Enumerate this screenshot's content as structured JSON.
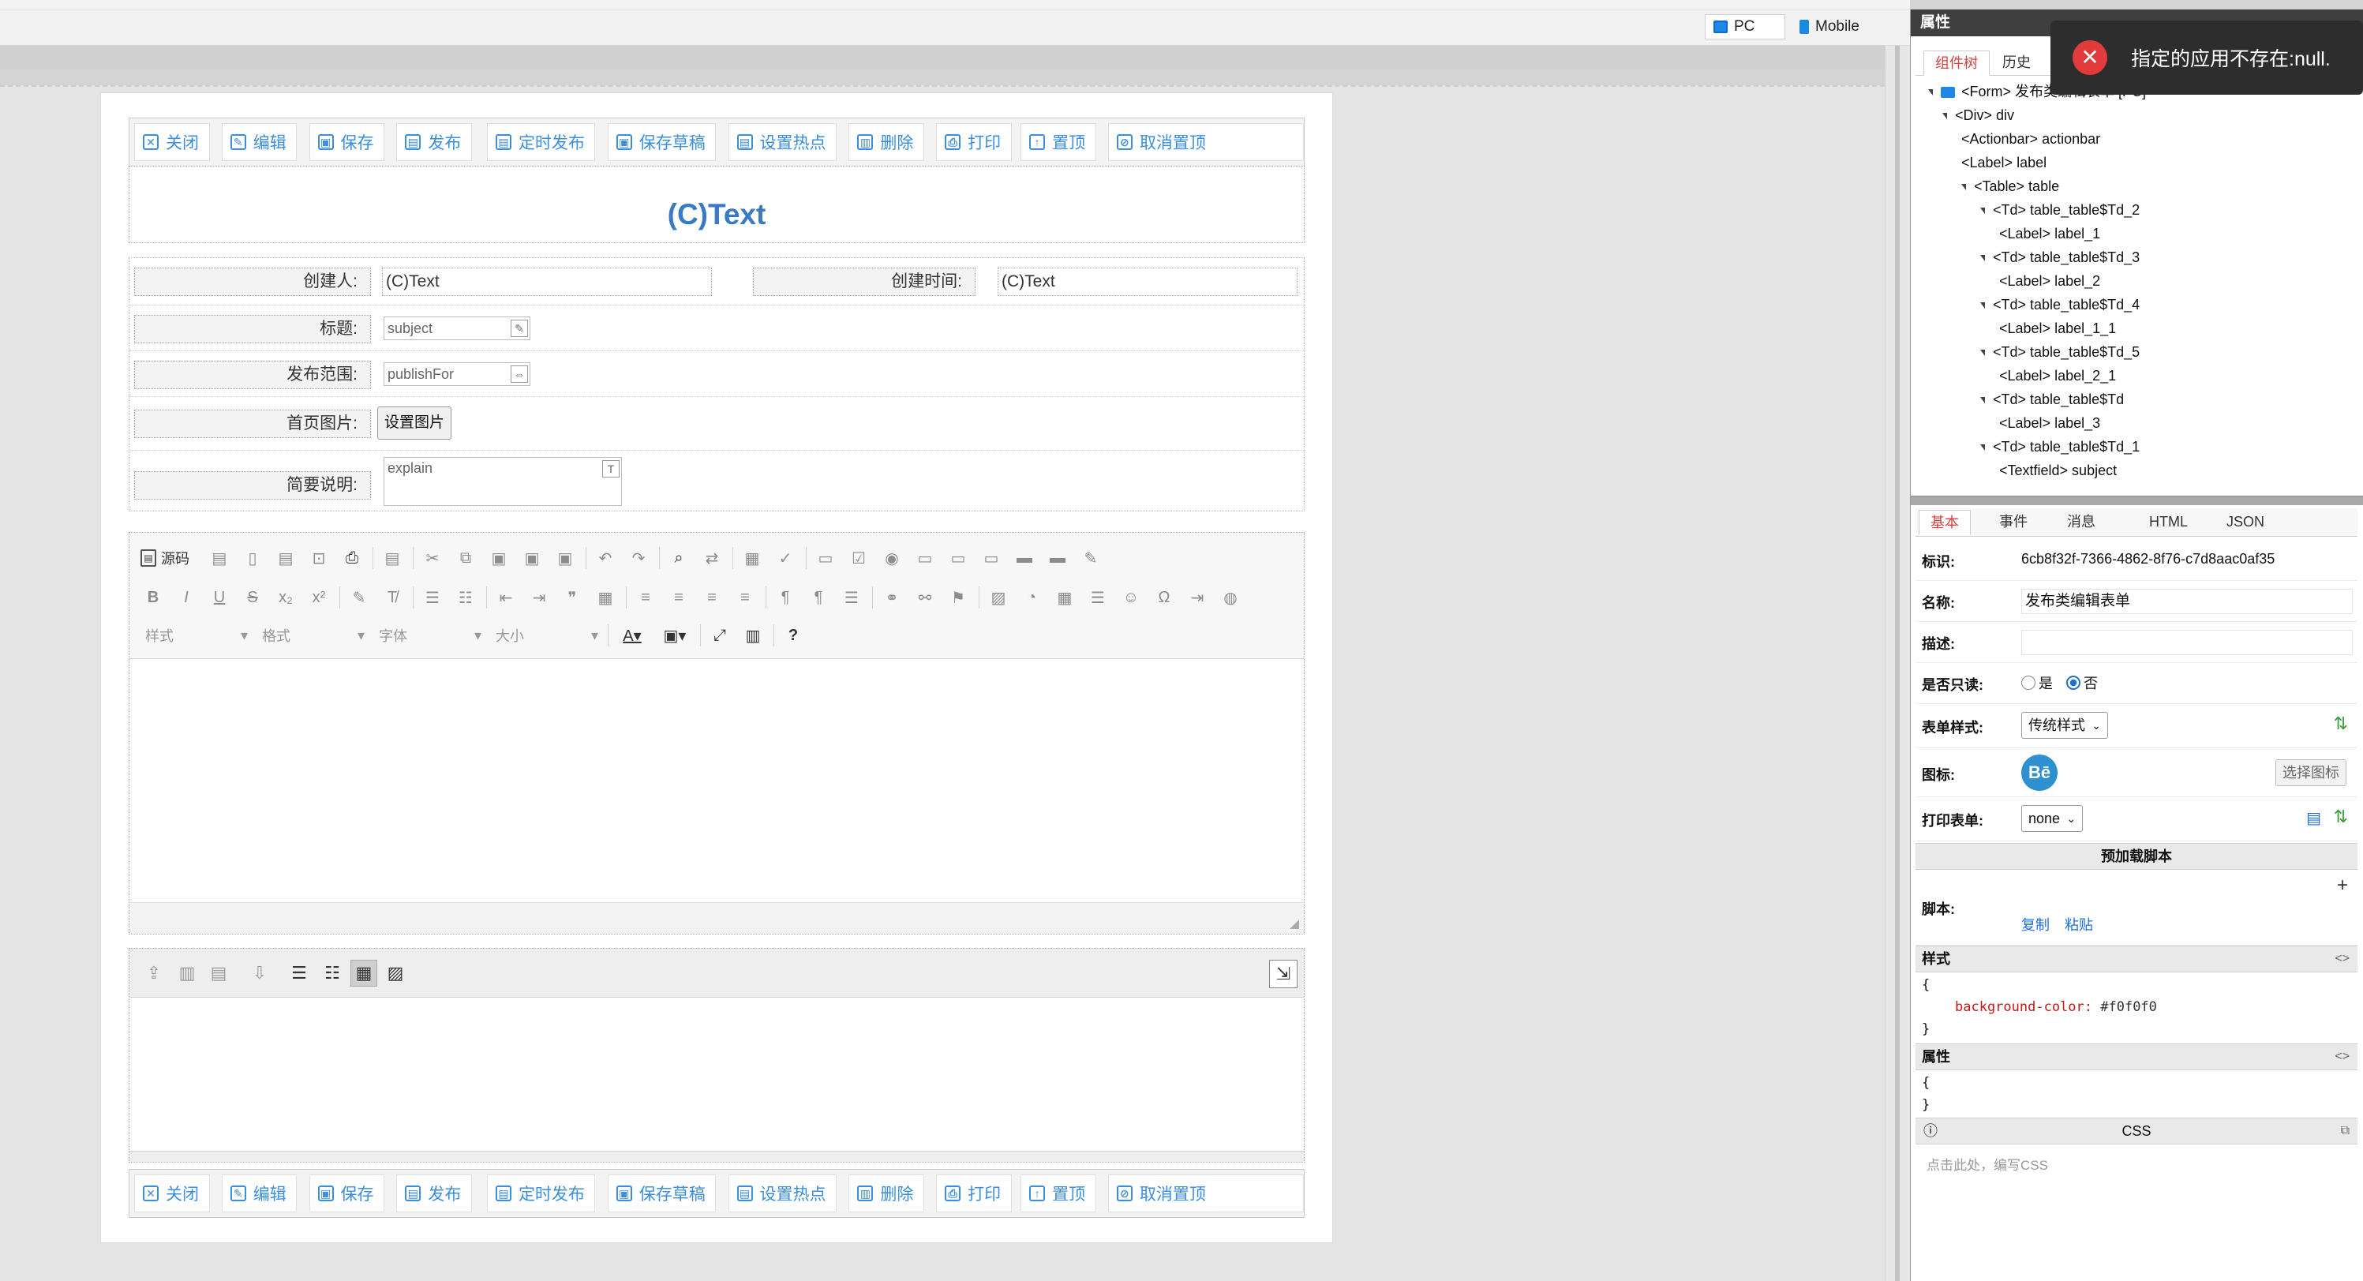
{
  "device_switch": {
    "pc": "PC",
    "mobile": "Mobile"
  },
  "actionbar": {
    "buttons": [
      {
        "label": "关闭",
        "icon": "close-icon",
        "glyph": "✕"
      },
      {
        "label": "编辑",
        "icon": "edit-pencil-icon",
        "glyph": "✎"
      },
      {
        "label": "保存",
        "icon": "save-icon",
        "glyph": "▣"
      },
      {
        "label": "发布",
        "icon": "publish-doc-icon",
        "glyph": "▤"
      },
      {
        "label": "定时发布",
        "icon": "scheduled-publish-icon",
        "glyph": "▤"
      },
      {
        "label": "保存草稿",
        "icon": "save-draft-icon",
        "glyph": "▣"
      },
      {
        "label": "设置热点",
        "icon": "hotspot-doc-icon",
        "glyph": "▤"
      },
      {
        "label": "删除",
        "icon": "trash-icon",
        "glyph": "▥"
      },
      {
        "label": "打印",
        "icon": "printer-icon",
        "glyph": "⎙"
      },
      {
        "label": "置顶",
        "icon": "pin-top-icon",
        "glyph": "↑"
      },
      {
        "label": "取消置顶",
        "icon": "cancel-top-icon",
        "glyph": "⊘"
      }
    ]
  },
  "form": {
    "title": "(C)Text",
    "creator_label": "创建人:",
    "creator_value": "(C)Text",
    "created_time_label": "创建时间:",
    "created_time_value": "(C)Text",
    "subject_label": "标题:",
    "subject_value": "subject",
    "publish_label": "发布范围:",
    "publish_value": "publishFor",
    "cover_label": "首页图片:",
    "cover_button": "设置图片",
    "explain_label": "简要说明:",
    "explain_value": "explain"
  },
  "editor": {
    "source_label": "源码",
    "combos": [
      "样式",
      "格式",
      "字体",
      "大小"
    ],
    "help": "?"
  },
  "panel": {
    "header": "属性",
    "tree_tabs": [
      "组件树",
      "历史"
    ],
    "tree": [
      "<Form> 发布类编辑表单 [PC]",
      "<Div> div",
      "<Actionbar> actionbar",
      "<Label> label",
      "<Table> table",
      "<Td> table_table$Td_2",
      "<Label> label_1",
      "<Td> table_table$Td_3",
      "<Label> label_2",
      "<Td> table_table$Td_4",
      "<Label> label_1_1",
      "<Td> table_table$Td_5",
      "<Label> label_2_1",
      "<Td> table_table$Td",
      "<Label> label_3",
      "<Td> table_table$Td_1",
      "<Textfield> subject"
    ],
    "prop_tabs": [
      "基本",
      "事件",
      "消息",
      "HTML",
      "JSON"
    ],
    "id_label": "标识:",
    "id_value": "6cb8f32f-7366-4862-8f76-c7d8aac0af35",
    "name_label": "名称:",
    "name_value": "发布类编辑表单",
    "desc_label": "描述:",
    "readonly_label": "是否只读:",
    "readonly_yes": "是",
    "readonly_no": "否",
    "style_label": "表单样式:",
    "style_value": "传统样式",
    "icon_label": "图标:",
    "icon_glyph": "Bē",
    "icon_button": "选择图标",
    "print_label": "打印表单:",
    "print_value": "none",
    "preload_header": "预加载脚本",
    "script_label": "脚本:",
    "copy": "复制",
    "paste": "粘贴",
    "style_section": "样式",
    "style_open": "{",
    "style_prop": "background-color:",
    "style_val": "#f0f0f0",
    "style_close": "}",
    "attr_section": "属性",
    "attr_open": "{",
    "attr_close": "}",
    "css_header": "CSS",
    "css_placeholder": "点击此处，编写CSS"
  },
  "toast": {
    "message": "指定的应用不存在:null."
  },
  "colors": {
    "accent": "#3b8ede",
    "title": "#3a79c3",
    "tab_active": "#d94141",
    "error": "#e23b3b"
  }
}
